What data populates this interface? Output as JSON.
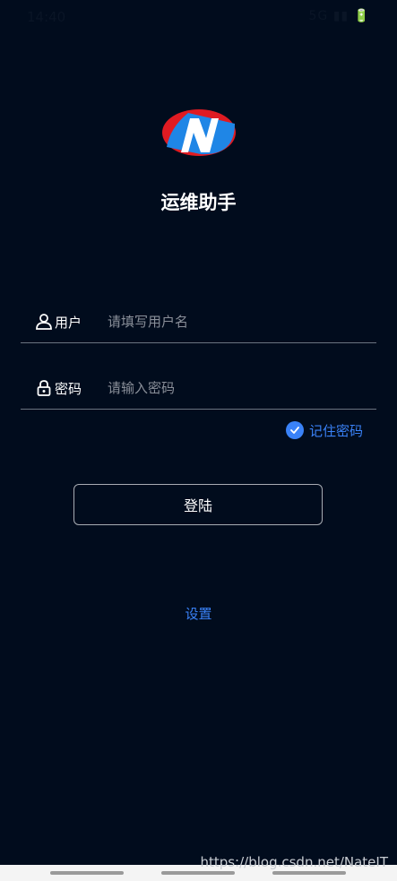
{
  "status_bar": {
    "time": "14:40",
    "icons": "5G ▮▮ 🔋"
  },
  "app": {
    "title": "运维助手"
  },
  "form": {
    "user_label": "用户",
    "user_placeholder": "请填写用户名",
    "user_value": "",
    "password_label": "密码",
    "password_placeholder": "请输入密码",
    "password_value": "",
    "remember_label": "记住密码",
    "remember_checked": true
  },
  "actions": {
    "login_label": "登陆",
    "settings_label": "设置"
  },
  "watermark": "https://blog.csdn.net/NateIT",
  "colors": {
    "background": "#010c1d",
    "accent": "#3a82f7",
    "logo_red": "#e01b22",
    "logo_blue": "#1f86e6"
  }
}
